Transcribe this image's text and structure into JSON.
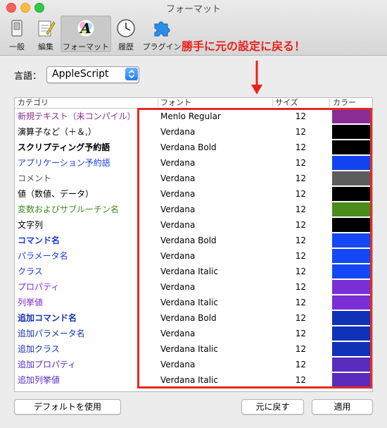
{
  "window": {
    "title": "フォーマット"
  },
  "toolbar": {
    "items": [
      {
        "label": "一般",
        "icon": "general-switch-icon"
      },
      {
        "label": "編集",
        "icon": "edit-notepad-icon"
      },
      {
        "label": "フォーマット",
        "icon": "format-letter-a-icon"
      },
      {
        "label": "履歴",
        "icon": "history-clock-icon"
      },
      {
        "label": "プラグイン",
        "icon": "plugin-puzzle-icon"
      }
    ],
    "selected": "フォーマット"
  },
  "annotation": {
    "text": "勝手に元の設定に戻る！",
    "color": "#e8221b"
  },
  "language": {
    "label": "言語：",
    "value": "AppleScript"
  },
  "table": {
    "headers": {
      "category": "カテゴリ",
      "font": "フォント",
      "size": "サイズ",
      "color": "カラー"
    },
    "rows": [
      {
        "category": "新規テキスト（未コンパイル）",
        "font": "Menlo Regular",
        "size": "12",
        "color": "#8a2d94",
        "text_color": "#8a2d94",
        "bold": false
      },
      {
        "category": "演算子など（＋＆,）",
        "font": "Verdana",
        "size": "12",
        "color": "#000000",
        "text_color": "#000000",
        "bold": false
      },
      {
        "category": "スクリプティング予約語",
        "font": "Verdana Bold",
        "size": "12",
        "color": "#000000",
        "text_color": "#000000",
        "bold": true
      },
      {
        "category": "アプリケーション予約語",
        "font": "Verdana",
        "size": "12",
        "color": "#1243ef",
        "text_color": "#1e3fdc",
        "bold": false
      },
      {
        "category": "コメント",
        "font": "Verdana",
        "size": "12",
        "color": "#5c5c5c",
        "text_color": "#555555",
        "bold": false
      },
      {
        "category": "値（数値、データ）",
        "font": "Verdana",
        "size": "12",
        "color": "#000000",
        "text_color": "#000000",
        "bold": false
      },
      {
        "category": "変数およびサブルーチン名",
        "font": "Verdana",
        "size": "12",
        "color": "#4a8c1b",
        "text_color": "#3f8a1a",
        "bold": false
      },
      {
        "category": "文字列",
        "font": "Verdana",
        "size": "12",
        "color": "#000000",
        "text_color": "#000000",
        "bold": false
      },
      {
        "category": "コマンド名",
        "font": "Verdana Bold",
        "size": "12",
        "color": "#1448f4",
        "text_color": "#1a3fd8",
        "bold": true
      },
      {
        "category": "パラメータ名",
        "font": "Verdana",
        "size": "12",
        "color": "#1448f4",
        "text_color": "#1a3fd8",
        "bold": false
      },
      {
        "category": "クラス",
        "font": "Verdana Italic",
        "size": "12",
        "color": "#1448f4",
        "text_color": "#1a3fd8",
        "bold": false
      },
      {
        "category": "プロパティ",
        "font": "Verdana",
        "size": "12",
        "color": "#7a2fd6",
        "text_color": "#7a2fd6",
        "bold": false
      },
      {
        "category": "列挙値",
        "font": "Verdana Italic",
        "size": "12",
        "color": "#7a2fd6",
        "text_color": "#7a2fd6",
        "bold": false
      },
      {
        "category": "追加コマンド名",
        "font": "Verdana Bold",
        "size": "12",
        "color": "#0f32b8",
        "text_color": "#1432b0",
        "bold": true
      },
      {
        "category": "追加パラメータ名",
        "font": "Verdana",
        "size": "12",
        "color": "#0f32b8",
        "text_color": "#1432b0",
        "bold": false
      },
      {
        "category": "追加クラス",
        "font": "Verdana Italic",
        "size": "12",
        "color": "#0f32b8",
        "text_color": "#1432b0",
        "bold": false
      },
      {
        "category": "追加プロパティ",
        "font": "Verdana",
        "size": "12",
        "color": "#5a2bbd",
        "text_color": "#5a2bbd",
        "bold": false
      },
      {
        "category": "追加列挙値",
        "font": "Verdana Italic",
        "size": "12",
        "color": "#5a2bbd",
        "text_color": "#5a2bbd",
        "bold": false
      }
    ]
  },
  "buttons": {
    "defaults": "デフォルトを使用",
    "revert": "元に戻す",
    "apply": "適用"
  }
}
